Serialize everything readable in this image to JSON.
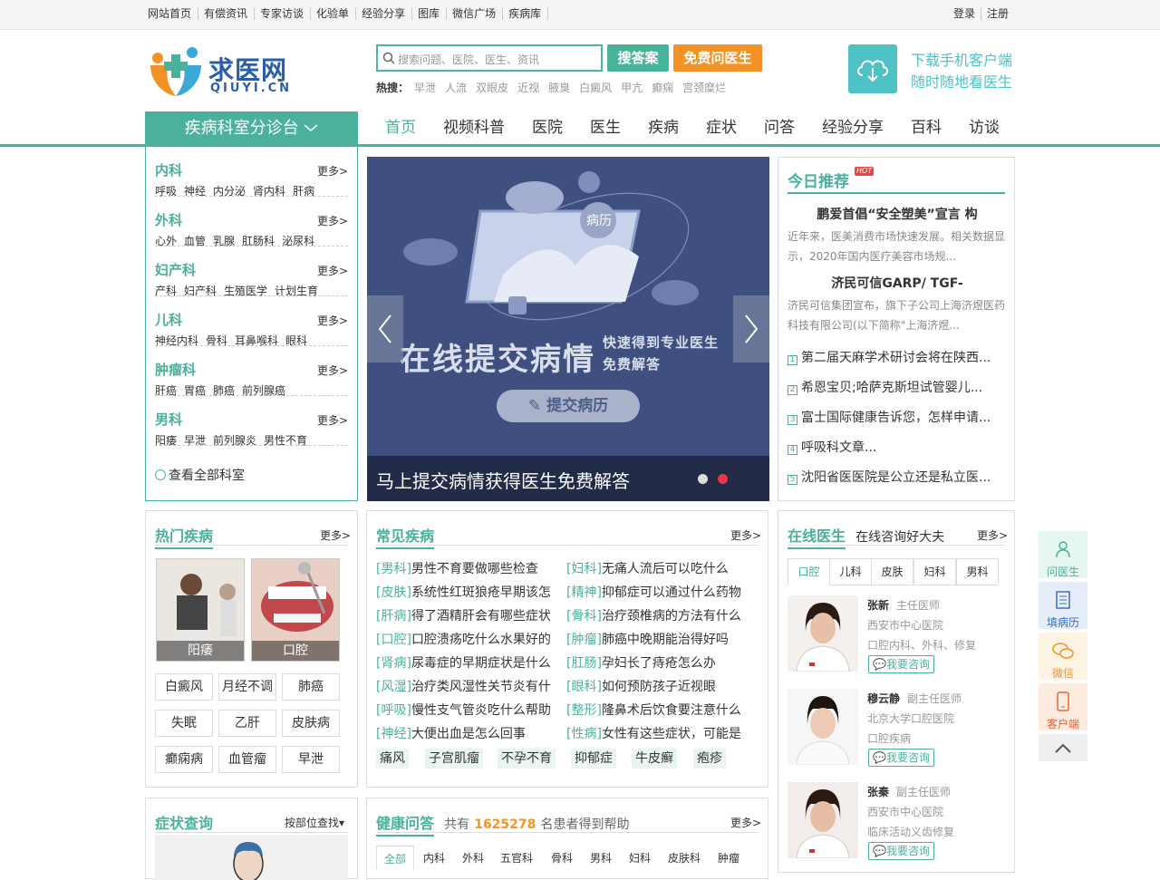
{
  "topbar": {
    "links": [
      "网站首页",
      "有偿资讯",
      "专家访谈",
      "化验单",
      "经验分享",
      "图库",
      "微信广场",
      "疾病库"
    ],
    "login": "登录",
    "register": "注册"
  },
  "logo": {
    "cn": "求医网",
    "en": "QIUYI.CN"
  },
  "search": {
    "placeholder": "搜索问题、医院、医生、资讯",
    "search_button": "搜答案",
    "ask_button": "免费问医生",
    "hot_label": "热搜：",
    "hot_terms": [
      "早泄",
      "人流",
      "双眼皮",
      "近视",
      "腋臭",
      "白癜风",
      "甲亢",
      "癫痫",
      "宫颈糜烂"
    ]
  },
  "app": {
    "line1": "下载手机客户端",
    "line2": "随时随地看医生"
  },
  "nav": {
    "dept_button": "疾病科室分诊台",
    "items": [
      "首页",
      "视频科普",
      "医院",
      "医生",
      "疾病",
      "症状",
      "问答",
      "经验分享",
      "百科",
      "访谈"
    ],
    "active": "首页"
  },
  "departments": [
    {
      "title": "内科",
      "more": "更多>",
      "subs": [
        "呼吸",
        "神经",
        "内分泌",
        "肾内科",
        "肝病"
      ]
    },
    {
      "title": "外科",
      "more": "更多>",
      "subs": [
        "心外",
        "血管",
        "乳腺",
        "肛肠科",
        "泌尿科"
      ]
    },
    {
      "title": "妇产科",
      "more": "更多>",
      "subs": [
        "产科",
        "妇产科",
        "生殖医学",
        "计划生育"
      ]
    },
    {
      "title": "儿科",
      "more": "更多>",
      "subs": [
        "神经内科",
        "骨科",
        "耳鼻喉科",
        "眼科"
      ]
    },
    {
      "title": "肿瘤科",
      "more": "更多>",
      "subs": [
        "肝癌",
        "胃癌",
        "肺癌",
        "前列腺癌"
      ]
    },
    {
      "title": "男科",
      "more": "更多>",
      "subs": [
        "阳痿",
        "早泄",
        "前列腺炎",
        "男性不育"
      ]
    }
  ],
  "all_departments": "查看全部科室",
  "banner": {
    "badge": "病历",
    "headline": "在线提交病情",
    "sub1": "快速得到专业医生",
    "sub2": "免费解答",
    "button": "提交病历",
    "caption": "马上提交病情获得医生免费解答"
  },
  "today": {
    "title": "今日推荐",
    "hot": "HOT",
    "articles": [
      {
        "headline": "鹏爱首倡“安全塑美”宣言 构",
        "desc": "近年来，医美消费市场快速发展。相关数据显示，2020年国内医疗美容市场规..."
      },
      {
        "headline": "济民可信GARP/ TGF-",
        "desc": "济民可信集团宣布，旗下子公司上海济煜医药科技有限公司(以下简称\"上海济煜..."
      }
    ],
    "list": [
      {
        "n": "1",
        "text": "第二届天麻学术研讨会将在陕西..."
      },
      {
        "n": "2",
        "text": "希恩宝贝;哈萨克斯坦试管婴儿..."
      },
      {
        "n": "3",
        "text": "富士国际健康告诉您，怎样申请..."
      },
      {
        "n": "4",
        "text": "呼吸科文章..."
      },
      {
        "n": "5",
        "text": "沈阳省医医院是公立还是私立医..."
      }
    ]
  },
  "hot_disease": {
    "title": "热门疾病",
    "more": "更多>",
    "pics": [
      "阳痿",
      "口腔"
    ],
    "tags": [
      "白癜风",
      "月经不调",
      "肺癌",
      "失眠",
      "乙肝",
      "皮肤病",
      "癫痫病",
      "血管瘤",
      "早泄"
    ]
  },
  "common_disease": {
    "title": "常见疾病",
    "more": "更多>",
    "left": [
      {
        "cat": "[男科]",
        "q": "男性不育要做哪些检查"
      },
      {
        "cat": "[皮肤]",
        "q": "系统性红斑狼疮早期该怎"
      },
      {
        "cat": "[肝病]",
        "q": "得了酒精肝会有哪些症状"
      },
      {
        "cat": "[口腔]",
        "q": "口腔溃疡吃什么水果好的"
      },
      {
        "cat": "[肾病]",
        "q": "尿毒症的早期症状是什么"
      },
      {
        "cat": "[风湿]",
        "q": "治疗类风湿性关节炎有什"
      },
      {
        "cat": "[呼吸]",
        "q": "慢性支气管炎吃什么帮助"
      },
      {
        "cat": "[神经]",
        "q": "大便出血是怎么回事"
      }
    ],
    "right": [
      {
        "cat": "[妇科]",
        "q": "无痛人流后可以吃什么"
      },
      {
        "cat": "[精神]",
        "q": "抑郁症可以通过什么药物"
      },
      {
        "cat": "[骨科]",
        "q": "治疗颈椎病的方法有什么"
      },
      {
        "cat": "[肿瘤]",
        "q": "肺癌中晚期能治得好吗"
      },
      {
        "cat": "[肛肠]",
        "q": "孕妇长了痔疮怎么办"
      },
      {
        "cat": "[眼科]",
        "q": "如何预防孩子近视眼"
      },
      {
        "cat": "[整形]",
        "q": "隆鼻术后饮食要注意什么"
      },
      {
        "cat": "[性病]",
        "q": "女性有这些症状，可能是"
      }
    ],
    "tags": [
      "痛风",
      "子宫肌瘤",
      "不孕不育",
      "抑郁症",
      "牛皮癣",
      "疱疹"
    ]
  },
  "online_doctor": {
    "title": "在线医生",
    "subtitle": "在线咨询好大夫",
    "more": "更多>",
    "tabs": [
      "口腔",
      "儿科",
      "皮肤",
      "妇科",
      "男科"
    ],
    "doctors": [
      {
        "name": "张新",
        "title": "主任医师",
        "hospital": "西安市中心医院",
        "specialty": "口腔内科、外科、修复",
        "ask": "我要咨询"
      },
      {
        "name": "穆云静",
        "title": "副主任医师",
        "hospital": "北京大学口腔医院",
        "specialty": "口腔疾病",
        "ask": "我要咨询"
      },
      {
        "name": "张秦",
        "title": "副主任医师",
        "hospital": "西安市中心医院",
        "specialty": "临床活动义齿修复",
        "ask": "我要咨询"
      }
    ]
  },
  "symptom": {
    "title": "症状查询",
    "by_part": "按部位查找"
  },
  "health_qa": {
    "title": "健康问答",
    "prefix": "共有",
    "count": "1625278",
    "suffix": "名患者得到帮助",
    "more": "更多>",
    "tabs": [
      "全部",
      "内科",
      "外科",
      "五官科",
      "骨科",
      "男科",
      "妇科",
      "皮肤科",
      "肿瘤"
    ]
  },
  "float_bar": [
    "问医生",
    "填病历",
    "微信",
    "客户端"
  ],
  "colors": {
    "brand": "#4bb19c",
    "orange": "#f39325",
    "app": "#4ec2c4"
  }
}
